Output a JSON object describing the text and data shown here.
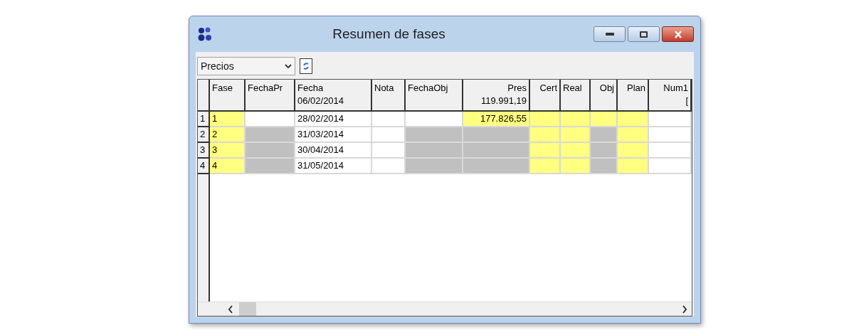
{
  "window": {
    "title": "Resumen de fases"
  },
  "toolbar": {
    "dropdown": {
      "value": "Precios"
    }
  },
  "table": {
    "columns": [
      {
        "label": "Fase",
        "kind": "text"
      },
      {
        "label": "FechaPr",
        "kind": "text"
      },
      {
        "label": "Fecha",
        "sub": "06/02/2014",
        "kind": "text"
      },
      {
        "label": "Nota",
        "kind": "text"
      },
      {
        "label": "FechaObj",
        "kind": "text"
      },
      {
        "label": "Pres",
        "sub": "119.991,19",
        "kind": "number"
      },
      {
        "label": "Cert",
        "kind": "number"
      },
      {
        "label": "Real",
        "kind": "text"
      },
      {
        "label": "Obj",
        "kind": "number"
      },
      {
        "label": "Plan",
        "kind": "number"
      },
      {
        "label": "Num1",
        "sub": "[",
        "kind": "number"
      }
    ],
    "rows": [
      {
        "header": "1",
        "cells": [
          {
            "text": "1",
            "kind": "editable"
          },
          {
            "kind": "plain"
          },
          {
            "text": "28/02/2014",
            "kind": "plain"
          },
          {
            "kind": "plain"
          },
          {
            "kind": "plain"
          },
          {
            "text": "177.826,55",
            "kind": "editable"
          },
          {
            "kind": "editable"
          },
          {
            "kind": "editable"
          },
          {
            "kind": "editable"
          },
          {
            "kind": "editable"
          },
          {
            "kind": "plain"
          }
        ]
      },
      {
        "header": "2",
        "cells": [
          {
            "text": "2",
            "kind": "editable"
          },
          {
            "kind": "disabled"
          },
          {
            "text": "31/03/2014",
            "kind": "plain"
          },
          {
            "kind": "plain"
          },
          {
            "kind": "disabled"
          },
          {
            "kind": "disabled"
          },
          {
            "kind": "editable"
          },
          {
            "kind": "editable"
          },
          {
            "kind": "disabled"
          },
          {
            "kind": "editable"
          },
          {
            "kind": "plain"
          }
        ]
      },
      {
        "header": "3",
        "cells": [
          {
            "text": "3",
            "kind": "editable"
          },
          {
            "kind": "disabled"
          },
          {
            "text": "30/04/2014",
            "kind": "plain"
          },
          {
            "kind": "plain"
          },
          {
            "kind": "disabled"
          },
          {
            "kind": "disabled"
          },
          {
            "kind": "editable"
          },
          {
            "kind": "editable"
          },
          {
            "kind": "disabled"
          },
          {
            "kind": "editable"
          },
          {
            "kind": "plain"
          }
        ]
      },
      {
        "header": "4",
        "cells": [
          {
            "text": "4",
            "kind": "editable"
          },
          {
            "kind": "disabled"
          },
          {
            "text": "31/05/2014",
            "kind": "plain"
          },
          {
            "kind": "plain"
          },
          {
            "kind": "disabled"
          },
          {
            "kind": "disabled"
          },
          {
            "kind": "editable"
          },
          {
            "kind": "editable"
          },
          {
            "kind": "disabled"
          },
          {
            "kind": "editable"
          },
          {
            "kind": "plain"
          }
        ]
      }
    ]
  }
}
